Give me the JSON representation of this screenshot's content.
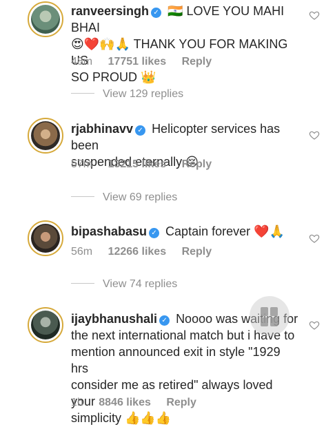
{
  "comments": [
    {
      "username": "ranveersingh",
      "text_lines": [
        "🇮🇳 LOVE YOU MAHI BHAI",
        "😍❤️🙌🙏 THANK YOU FOR MAKING US",
        "SO PROUD 👑"
      ],
      "time": "48m",
      "likes": "17751 likes",
      "reply": "Reply",
      "view_replies": "View 129 replies",
      "avatar_color": "#6b8f7a"
    },
    {
      "username": "rjabhinavv",
      "text_lines": [
        "Helicopter services has been",
        "suspended eternally 😔"
      ],
      "time": "57m",
      "likes": "13215 likes",
      "reply": "Reply",
      "view_replies": "View 69 replies",
      "avatar_color": "#8a6a4a"
    },
    {
      "username": "bipashabasu",
      "text_lines": [
        "Captain forever ❤️🙏"
      ],
      "time": "56m",
      "likes": "12266 likes",
      "reply": "Reply",
      "view_replies": "View 74 replies",
      "avatar_color": "#5a4a3a"
    },
    {
      "username": "ijaybhanushali",
      "text_lines": [
        "Noooo was waiting for",
        "the next international match but i have to",
        "mention announced exit  in style \"1929 hrs",
        "consider me as retired\" always loved your",
        "simplicity 👍👍👍"
      ],
      "time": "1h",
      "likes": "8846 likes",
      "reply": "Reply",
      "avatar_color": "#4a5a50"
    }
  ],
  "colors": {
    "verified": "#3897f0",
    "ring": "#d6a93a",
    "muted": "#8e8e8e"
  }
}
